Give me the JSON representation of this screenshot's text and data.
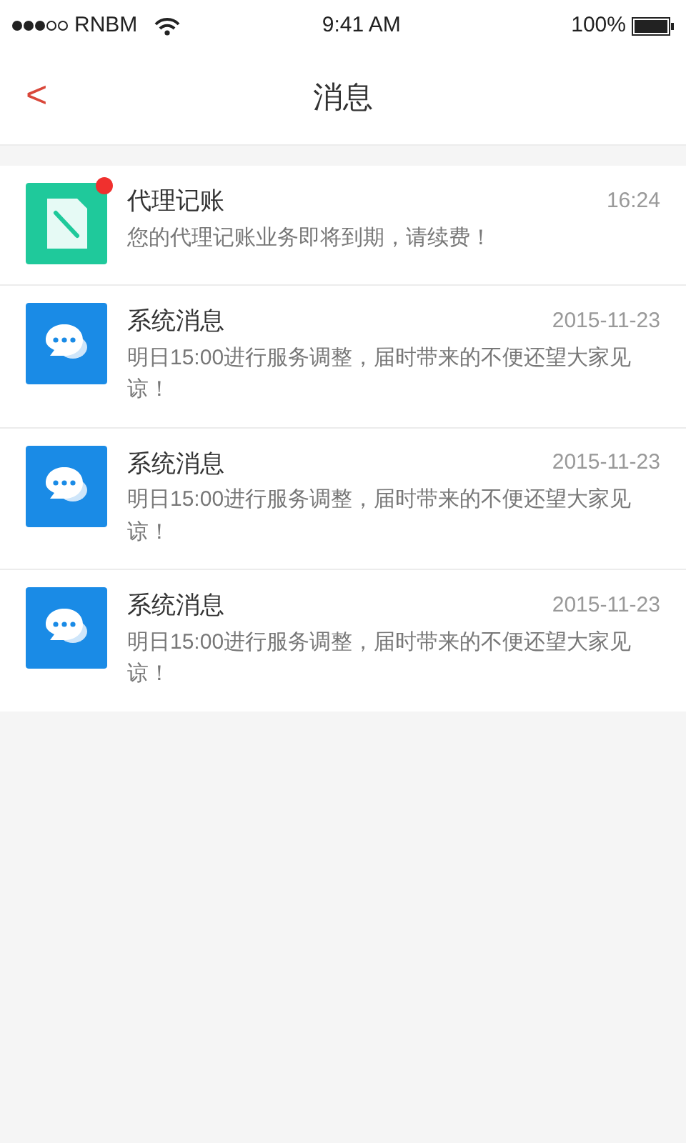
{
  "status_bar": {
    "carrier": "RNBM",
    "time": "9:41 AM",
    "battery": "100%"
  },
  "nav": {
    "back": "<",
    "title": "消息"
  },
  "messages": [
    {
      "kind": "notice",
      "title": "代理记账",
      "time": "16:24",
      "body": "您的代理记账业务即将到期，请续费！",
      "unread": true
    },
    {
      "kind": "system",
      "title": "系统消息",
      "time": "2015-11-23",
      "body": "明日15:00进行服务调整，届时带来的不便还望大家见谅！",
      "unread": false
    },
    {
      "kind": "system",
      "title": "系统消息",
      "time": "2015-11-23",
      "body": "明日15:00进行服务调整，届时带来的不便还望大家见谅！",
      "unread": false
    },
    {
      "kind": "system",
      "title": "系统消息",
      "time": "2015-11-23",
      "body": "明日15:00进行服务调整，届时带来的不便还望大家见谅！",
      "unread": false
    }
  ]
}
